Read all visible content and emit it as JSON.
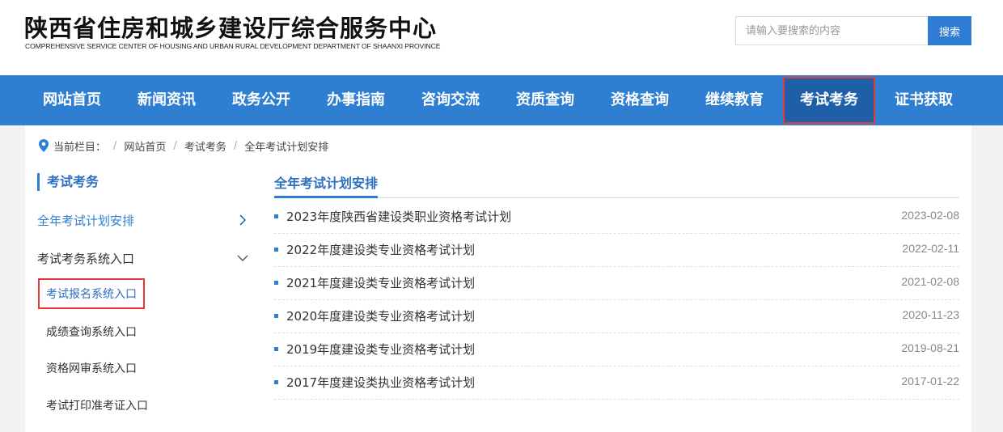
{
  "header": {
    "title": "陕西省住房和城乡建设厅综合服务中心",
    "subtitle": "COMPREHENSIVE SERVICE CENTER OF HOUSING AND URBAN RURAL DEVELOPMENT DEPARTMENT OF SHAANXI PROVINCE",
    "search_placeholder": "请输入要搜索的内容",
    "search_button": "搜索"
  },
  "nav": {
    "items": [
      {
        "label": "网站首页"
      },
      {
        "label": "新闻资讯"
      },
      {
        "label": "政务公开"
      },
      {
        "label": "办事指南"
      },
      {
        "label": "咨询交流"
      },
      {
        "label": "资质查询"
      },
      {
        "label": "资格查询"
      },
      {
        "label": "继续教育"
      },
      {
        "label": "考试考务"
      },
      {
        "label": "证书获取"
      }
    ],
    "active": "考试考务"
  },
  "breadcrumb": {
    "prefix": "当前栏目：",
    "items": [
      "网站首页",
      "考试考务",
      "全年考试计划安排"
    ]
  },
  "sidebar": {
    "title": "考试考务",
    "items": [
      {
        "label": "全年考试计划安排",
        "icon": "chevron-right-icon"
      },
      {
        "label": "考试考务系统入口",
        "icon": "chevron-down-icon"
      }
    ],
    "sub_items": [
      {
        "label": "考试报名系统入口"
      },
      {
        "label": "成绩查询系统入口"
      },
      {
        "label": "资格网审系统入口"
      },
      {
        "label": "考试打印准考证入口"
      }
    ]
  },
  "main": {
    "title": "全年考试计划安排",
    "list": [
      {
        "title": "2023年度陕西省建设类职业资格考试计划",
        "date": "2023-02-08"
      },
      {
        "title": "2022年度建设类专业资格考试计划",
        "date": "2022-02-11"
      },
      {
        "title": "2021年度建设类专业资格考试计划",
        "date": "2021-02-08"
      },
      {
        "title": "2020年度建设类专业资格考试计划",
        "date": "2020-11-23"
      },
      {
        "title": "2019年度建设类专业资格考试计划",
        "date": "2019-08-21"
      },
      {
        "title": "2017年度建设类执业资格考试计划",
        "date": "2017-01-22"
      }
    ]
  },
  "colors": {
    "nav_bg": "#2e7fd2",
    "nav_active_bg": "#1f5fa8",
    "highlight_border": "#e53935",
    "accent_text": "#2e6fc0"
  }
}
